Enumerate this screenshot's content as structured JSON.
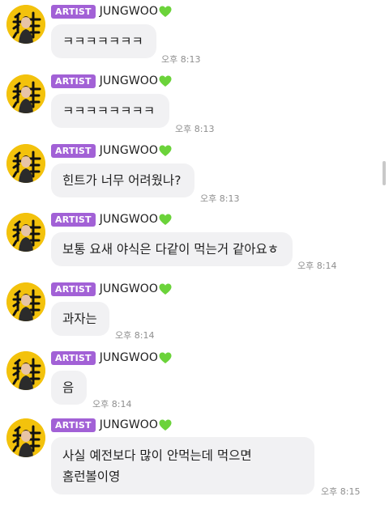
{
  "sender": {
    "badge": "ARTIST",
    "name": "JUNGWOO",
    "heart_icon": "green-heart-icon",
    "heart_color": "#6bd33a",
    "badge_color": "#a261d6",
    "avatar_bg": "#f3c20c"
  },
  "messages": [
    {
      "text": "ㅋㅋㅋㅋㅋㅋㅋ",
      "time": "오후 8:13"
    },
    {
      "text": "ㅋㅋㅋㅋㅋㅋㅋㅋ",
      "time": "오후 8:13"
    },
    {
      "text": "힌트가 너무 어려웠나?",
      "time": "오후 8:13"
    },
    {
      "text": "보통 요새 야식은 다같이 먹는거 같아요ㅎ",
      "time": "오후 8:14"
    },
    {
      "text": "과자는",
      "time": "오후 8:14"
    },
    {
      "text": "음",
      "time": "오후 8:14"
    },
    {
      "lines": [
        "사실 예전보다 많이 안먹는데 먹으면",
        "홈런볼이영"
      ],
      "time": "오후 8:15"
    }
  ]
}
